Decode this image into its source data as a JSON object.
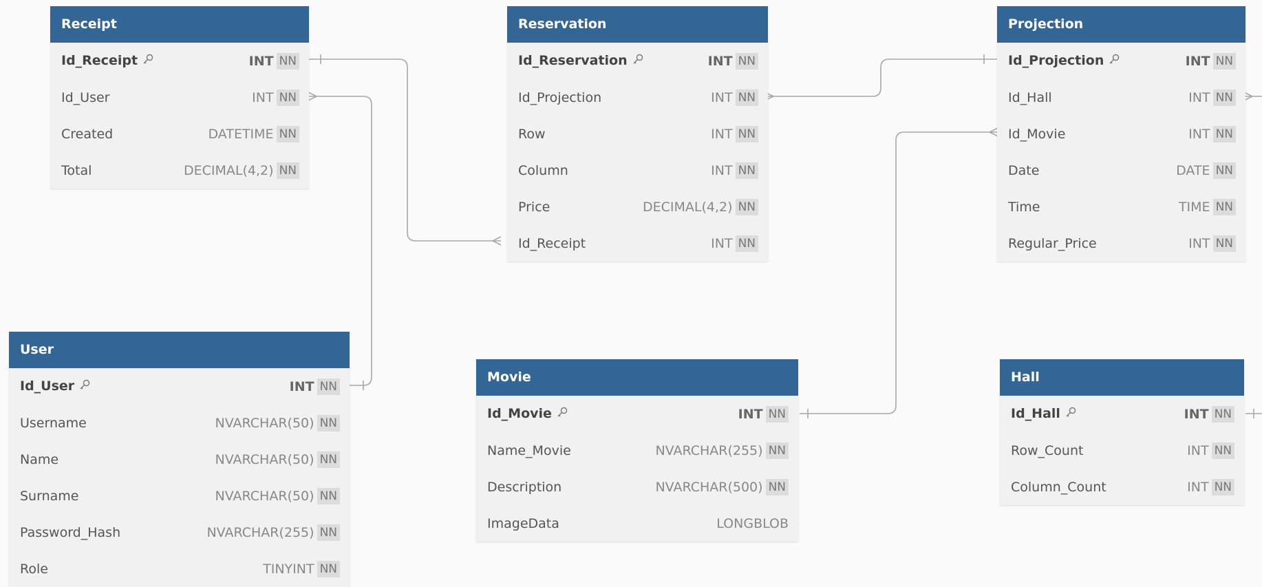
{
  "tables": {
    "receipt": {
      "title": "Receipt",
      "columns": [
        {
          "name": "Id_Receipt",
          "type": "INT",
          "nn": "NN"
        },
        {
          "name": "Id_User",
          "type": "INT",
          "nn": "NN"
        },
        {
          "name": "Created",
          "type": "DATETIME",
          "nn": "NN"
        },
        {
          "name": "Total",
          "type": "DECIMAL(4,2)",
          "nn": "NN"
        }
      ]
    },
    "reservation": {
      "title": "Reservation",
      "columns": [
        {
          "name": "Id_Reservation",
          "type": "INT",
          "nn": "NN"
        },
        {
          "name": "Id_Projection",
          "type": "INT",
          "nn": "NN"
        },
        {
          "name": "Row",
          "type": "INT",
          "nn": "NN"
        },
        {
          "name": "Column",
          "type": "INT",
          "nn": "NN"
        },
        {
          "name": "Price",
          "type": "DECIMAL(4,2)",
          "nn": "NN"
        },
        {
          "name": "Id_Receipt",
          "type": "INT",
          "nn": "NN"
        }
      ]
    },
    "projection": {
      "title": "Projection",
      "columns": [
        {
          "name": "Id_Projection",
          "type": "INT",
          "nn": "NN"
        },
        {
          "name": "Id_Hall",
          "type": "INT",
          "nn": "NN"
        },
        {
          "name": "Id_Movie",
          "type": "INT",
          "nn": "NN"
        },
        {
          "name": "Date",
          "type": "DATE",
          "nn": "NN"
        },
        {
          "name": "Time",
          "type": "TIME",
          "nn": "NN"
        },
        {
          "name": "Regular_Price",
          "type": "INT",
          "nn": "NN"
        }
      ]
    },
    "user": {
      "title": "User",
      "columns": [
        {
          "name": "Id_User",
          "type": "INT",
          "nn": "NN"
        },
        {
          "name": "Username",
          "type": "NVARCHAR(50)",
          "nn": "NN"
        },
        {
          "name": "Name",
          "type": "NVARCHAR(50)",
          "nn": "NN"
        },
        {
          "name": "Surname",
          "type": "NVARCHAR(50)",
          "nn": "NN"
        },
        {
          "name": "Password_Hash",
          "type": "NVARCHAR(255)",
          "nn": "NN"
        },
        {
          "name": "Role",
          "type": "TINYINT",
          "nn": "NN"
        }
      ]
    },
    "movie": {
      "title": "Movie",
      "columns": [
        {
          "name": "Id_Movie",
          "type": "INT",
          "nn": "NN"
        },
        {
          "name": "Name_Movie",
          "type": "NVARCHAR(255)",
          "nn": "NN"
        },
        {
          "name": "Description",
          "type": "NVARCHAR(500)",
          "nn": "NN"
        },
        {
          "name": "ImageData",
          "type": "LONGBLOB",
          "nn": ""
        }
      ]
    },
    "hall": {
      "title": "Hall",
      "columns": [
        {
          "name": "Id_Hall",
          "type": "INT",
          "nn": "NN"
        },
        {
          "name": "Row_Count",
          "type": "INT",
          "nn": "NN"
        },
        {
          "name": "Column_Count",
          "type": "INT",
          "nn": "NN"
        }
      ]
    }
  },
  "colors": {
    "header": "#336694",
    "connector": "#a8a8a8"
  }
}
